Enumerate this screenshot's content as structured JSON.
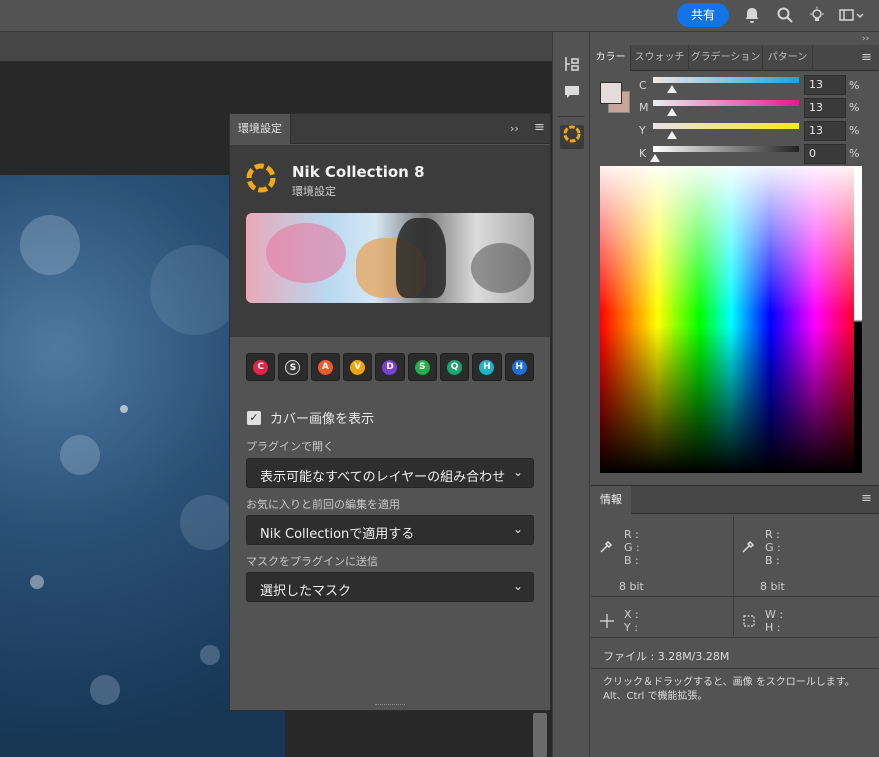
{
  "topbar": {
    "share_label": "共有"
  },
  "nik_panel": {
    "tab_label": "環境設定",
    "title": "Nik Collection 8",
    "subtitle": "環境設定",
    "plugins": [
      {
        "letter": "C",
        "color": "#e3234c"
      },
      {
        "letter": "S",
        "color": "#3a3a3a"
      },
      {
        "letter": "A",
        "color": "#ef5a2a"
      },
      {
        "letter": "V",
        "color": "#f1a20f"
      },
      {
        "letter": "D",
        "color": "#7b3fd1"
      },
      {
        "letter": "S",
        "color": "#21b04b"
      },
      {
        "letter": "Q",
        "color": "#17a870"
      },
      {
        "letter": "H",
        "color": "#1bb3c7"
      },
      {
        "letter": "H",
        "color": "#1e6fd6"
      }
    ],
    "cover_checkbox_label": "カバー画像を表示",
    "cover_checked": true,
    "open_label": "プラグインで開く",
    "open_value": "表示可能なすべてのレイヤーの組み合わせ",
    "apply_label": "お気に入りと前回の編集を適用",
    "apply_value": "Nik Collectionで適用する",
    "mask_label": "マスクをプラグインに送信",
    "mask_value": "選択したマスク"
  },
  "color_panel": {
    "tabs": [
      "カラー",
      "スウォッチ",
      "グラデーション",
      "パターン"
    ],
    "sliders": [
      {
        "label": "C",
        "value": "13",
        "percent": "%",
        "gradient": "linear-gradient(90deg,#f0e6e3,#1aa5d8)",
        "level": 0.13
      },
      {
        "label": "M",
        "value": "13",
        "percent": "%",
        "gradient": "linear-gradient(90deg,#e6f0f0,#e6188c)",
        "level": 0.13
      },
      {
        "label": "Y",
        "value": "13",
        "percent": "%",
        "gradient": "linear-gradient(90deg,#e8e2ec,#f6e81a)",
        "level": 0.13
      },
      {
        "label": "K",
        "value": "0",
        "percent": "%",
        "gradient": "linear-gradient(90deg,#ffffff,#222222)",
        "level": 0.0
      }
    ],
    "foreground_color": "#e5dbd9",
    "background_color": "#c7a699"
  },
  "info_panel": {
    "tab_label": "情報",
    "rgb_labels": [
      "R :",
      "G :",
      "B :"
    ],
    "bit_depth_left": "8 bit",
    "bit_depth_right": "8 bit",
    "xy_labels": [
      "X :",
      "Y :"
    ],
    "wh_labels": [
      "W :",
      "H :"
    ],
    "file_info": "ファイル : 3.28M/3.28M",
    "hint": "クリック＆ドラッグすると、画像 をスクロールします。Alt、Ctrl で機能拡張。"
  }
}
